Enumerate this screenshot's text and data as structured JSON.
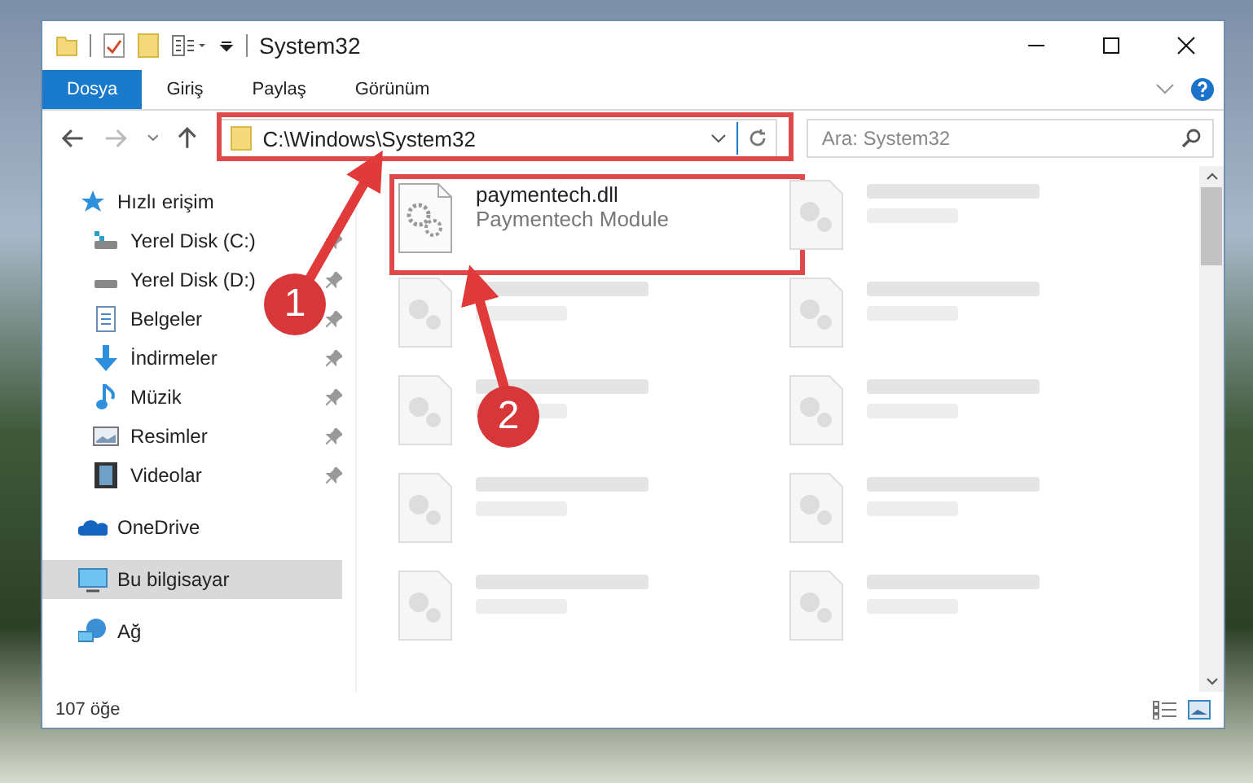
{
  "window": {
    "title": "System32"
  },
  "ribbon_tabs": [
    {
      "label": "Dosya",
      "selected": true
    },
    {
      "label": "Giriş",
      "selected": false
    },
    {
      "label": "Paylaş",
      "selected": false
    },
    {
      "label": "Görünüm",
      "selected": false
    }
  ],
  "address_bar": {
    "path": "C:\\Windows\\System32"
  },
  "search": {
    "placeholder": "Ara: System32"
  },
  "sidebar": {
    "items": [
      {
        "kind": "quick",
        "label": "Hızlı erişim",
        "selected": false,
        "children": [
          {
            "kind": "disk-c",
            "label": "Yerel Disk (C:)",
            "pinned": true,
            "selected": false
          },
          {
            "kind": "disk",
            "label": "Yerel Disk (D:)",
            "pinned": true,
            "selected": false
          },
          {
            "kind": "docs",
            "label": "Belgeler",
            "pinned": true,
            "selected": false
          },
          {
            "kind": "download",
            "label": "İndirmeler",
            "pinned": true,
            "selected": false
          },
          {
            "kind": "music",
            "label": "Müzik",
            "pinned": true,
            "selected": false
          },
          {
            "kind": "pictures",
            "label": "Resimler",
            "pinned": true,
            "selected": false
          },
          {
            "kind": "videos",
            "label": "Videolar",
            "pinned": true,
            "selected": false
          }
        ]
      },
      {
        "kind": "onedrive",
        "label": "OneDrive",
        "selected": false
      },
      {
        "kind": "pc",
        "label": "Bu bilgisayar",
        "selected": true
      },
      {
        "kind": "network",
        "label": "Ağ",
        "selected": false
      }
    ]
  },
  "files": [
    {
      "name": "paymentech.dll",
      "description": "Paymentech Module",
      "blurred": false,
      "highlighted": true
    },
    {
      "blurred": true
    },
    {
      "blurred": true
    },
    {
      "blurred": true
    },
    {
      "blurred": true
    },
    {
      "blurred": true
    },
    {
      "blurred": true
    },
    {
      "blurred": true
    },
    {
      "blurred": true
    },
    {
      "blurred": true
    }
  ],
  "status_bar": {
    "count": "107 öğe"
  },
  "annotations": [
    {
      "label": "1"
    },
    {
      "label": "2"
    }
  ]
}
